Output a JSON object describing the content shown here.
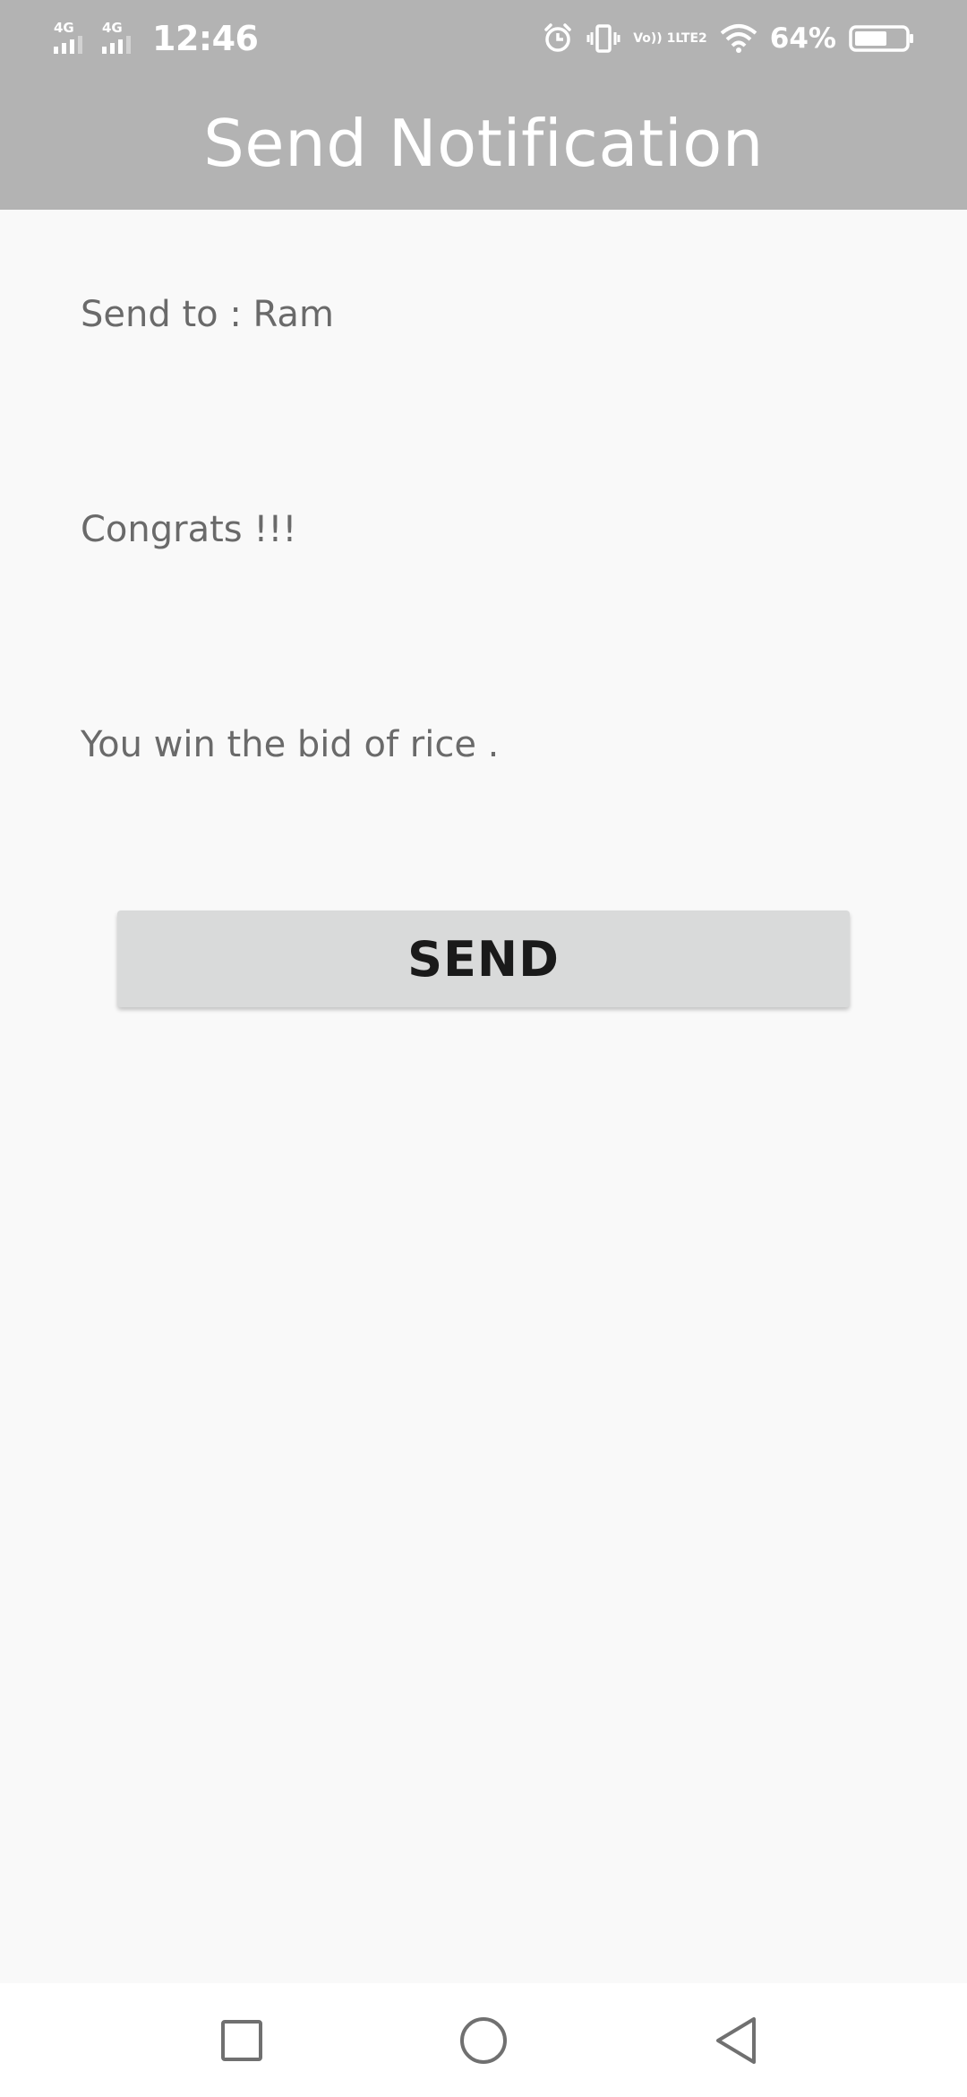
{
  "status_bar": {
    "sim1_network": "4G",
    "sim2_network": "4G",
    "time": "12:46",
    "volte_top": "Vo)) 1",
    "volte_bottom": "LTE2",
    "battery_percent": "64%",
    "battery_level": 0.64,
    "icons": [
      "signal-icon",
      "signal-icon",
      "alarm-icon",
      "vibrate-icon",
      "volte-icon",
      "wifi-icon",
      "battery-icon"
    ]
  },
  "header": {
    "title": "Send Notification"
  },
  "form": {
    "send_to": "Send to : Ram",
    "subject": "Congrats !!!",
    "message": "You win the bid of rice ."
  },
  "actions": {
    "send_label": "SEND"
  },
  "nav_bar": {
    "icons": [
      "recents-icon",
      "home-icon",
      "back-icon"
    ]
  },
  "colors": {
    "app_bar": "#b3b3b3",
    "background": "#f9f9f9",
    "button": "#d9dada",
    "text": "#6a6a6a"
  }
}
